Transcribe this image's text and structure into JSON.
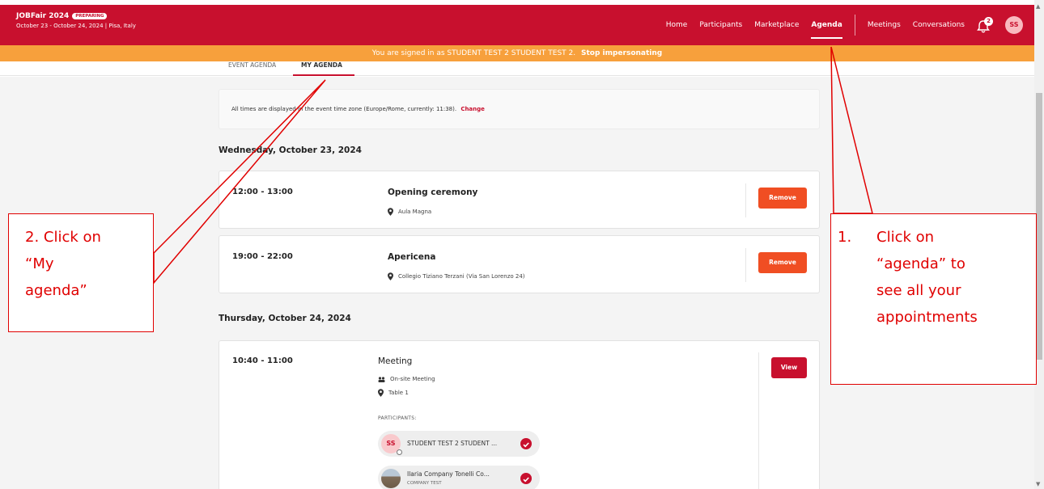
{
  "app": {
    "title": "JOBFair 2024",
    "status_badge": "PREPARING",
    "subtitle": "October 23 - October 24, 2024 | Pisa, Italy"
  },
  "nav": {
    "home": "Home",
    "participants": "Participants",
    "marketplace": "Marketplace",
    "agenda": "Agenda",
    "meetings": "Meetings",
    "conversations": "Conversations",
    "notification_count": "2",
    "user_initials": "SS",
    "icons": [
      "bell-icon"
    ]
  },
  "impersonation": {
    "message": "You are signed in as STUDENT TEST 2 STUDENT TEST 2.",
    "stop_label": "Stop impersonating"
  },
  "tabs": {
    "event_agenda": "EVENT AGENDA",
    "my_agenda": "MY AGENDA"
  },
  "timezone": {
    "text": "All times are displayed in the event time zone (Europe/Rome, currently: 11:38).",
    "change_label": "Change"
  },
  "days": [
    {
      "heading": "Wednesday, October 23, 2024",
      "events": [
        {
          "time": "12:00 - 13:00",
          "title": "Opening ceremony",
          "location": "Aula Magna",
          "button": "Remove"
        },
        {
          "time": "19:00 - 22:00",
          "title": "Apericena",
          "location": "Collegio Tiziano Terzani (Via San Lorenzo 24)",
          "button": "Remove"
        }
      ]
    },
    {
      "heading": "Thursday, October 24, 2024",
      "events": [
        {
          "time": "10:40 - 11:00",
          "title": "Meeting",
          "type": "On-site Meeting",
          "location": "Table 1",
          "button": "View",
          "participants_label": "PARTICIPANTS:",
          "participants": [
            {
              "initials": "SS",
              "name": "STUDENT TEST 2 STUDENT ..."
            },
            {
              "name": "Ilaria Company Tonelli Co...",
              "company": "COMPANY TEST"
            }
          ]
        }
      ]
    }
  ],
  "annotations": {
    "step1": [
      "1.",
      "Click on",
      "“agenda” to",
      "see all your",
      "appointments"
    ],
    "step2": [
      "2. Click on",
      "“My",
      "agenda”"
    ]
  },
  "colors": {
    "brand": "#c8102e",
    "impersonation_bar": "#f7a03c",
    "remove_button": "#f04e23",
    "annotation": "#e00000"
  }
}
